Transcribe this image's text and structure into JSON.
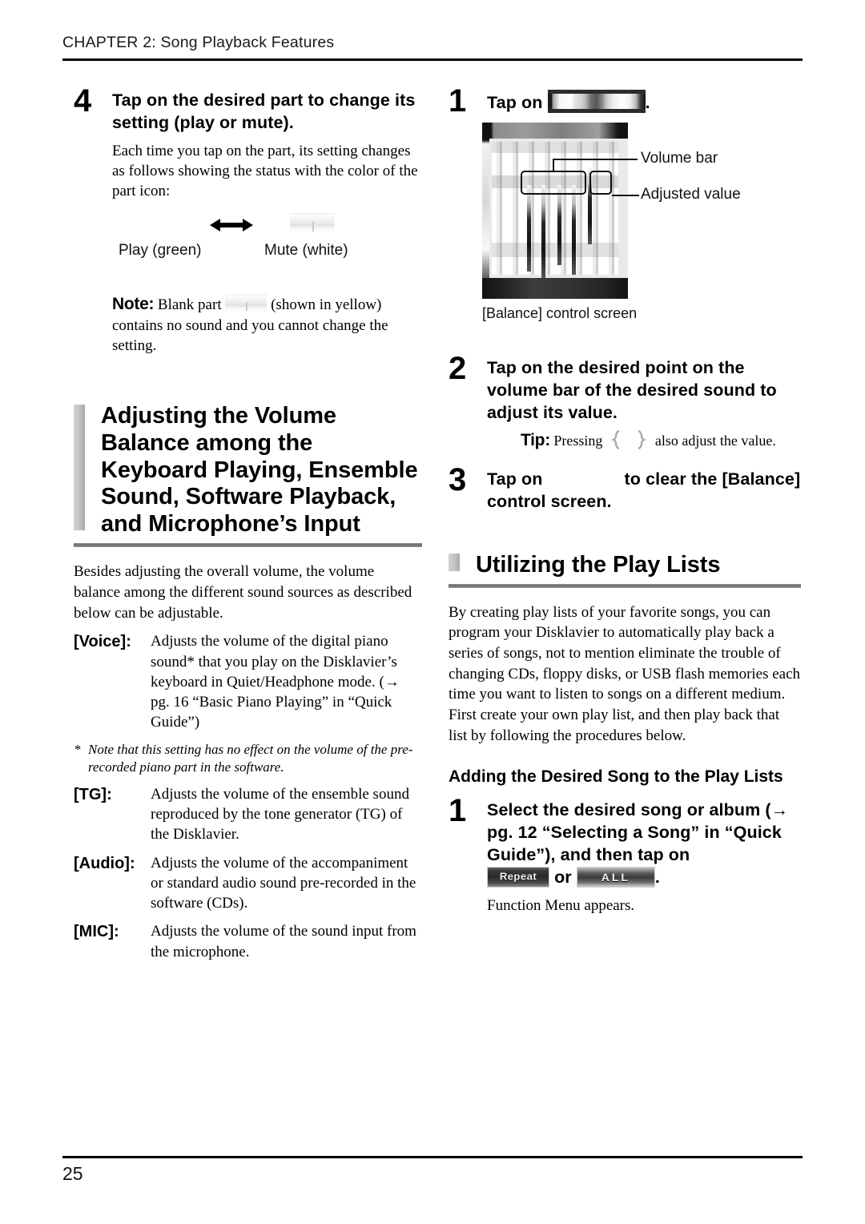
{
  "running_head": "CHAPTER 2: Song Playback Features",
  "page_number": "25",
  "left_column": {
    "step4": {
      "number": "4",
      "title": "Tap on the desired part to change its setting (play or mute).",
      "body": "Each time you tap on the part, its setting changes as follows showing the status with the color of the part icon:"
    },
    "legend": {
      "play_label": "Play (green)",
      "mute_label": "Mute (white)",
      "arrow_icon": "left-right-arrow-icon",
      "mute_icon": "part-icon-white"
    },
    "note": {
      "label": "Note:",
      "text_before_icon": "Blank part",
      "text_after_icon": "(shown in yellow) contains no sound and you cannot change the setting.",
      "blank_part_icon": "part-icon-blank"
    },
    "section_heading": "Adjusting the Volume Balance among the Keyboard Playing, Ensemble Sound, Software Playback, and Microphone’s Input",
    "intro": "Besides adjusting the overall volume, the volume balance among the different sound sources as described below can be adjustable.",
    "definitions": [
      {
        "term": "[Voice]:",
        "desc": "Adjusts the volume of the digital piano sound* that you play on the Disklavier’s keyboard in Quiet/Headphone mode. (→ pg. 16 “Basic Piano Playing” in “Quick Guide”)"
      },
      {
        "term": "[TG]:",
        "desc": "Adjusts the volume of the ensemble sound reproduced by the tone generator (TG) of the Disklavier."
      },
      {
        "term": "[Audio]:",
        "desc": "Adjusts the volume of the accompaniment or standard audio sound pre-recorded in the software (CDs)."
      },
      {
        "term": "[MIC]:",
        "desc": "Adjusts the volume of the sound input from the microphone."
      }
    ],
    "footnote": {
      "marker": "*",
      "text": "Note that this setting has no effect on the volume of the pre-recorded piano part in the software."
    }
  },
  "right_column": {
    "step1": {
      "number": "1",
      "title_before_icon": "Tap on",
      "title_after_icon": ".",
      "icon": "volume-bar-button-icon"
    },
    "figure": {
      "callout_volume_bar": "Volume bar",
      "callout_adjusted_value": "Adjusted value",
      "caption": "[Balance] control screen"
    },
    "step2": {
      "number": "2",
      "title": "Tap on the desired point on the volume bar of the desired sound to adjust its value.",
      "tip_label": "Tip:",
      "tip_before_icons": "Pressing",
      "tip_after_icons": "also adjust the value.",
      "tip_icon_left": "jog-dial-left-icon",
      "tip_icon_right": "jog-dial-right-icon"
    },
    "step3": {
      "number": "3",
      "title_before_icon": "Tap on",
      "title_after_icon": "to clear the [Balance] control screen.",
      "icon": "close-button-icon-faded"
    },
    "section_heading": "Utilizing the Play Lists",
    "intro": "By creating play lists of your favorite songs, you can program your Disklavier to automatically play back a series of songs, not to mention eliminate the trouble of changing CDs, floppy disks, or USB flash memories each time you want to listen to songs on a different medium. First create your own play list, and then play back that list by following the procedures below.",
    "sub_heading": "Adding the Desired Song to the Play Lists",
    "step1b": {
      "number": "1",
      "title": "Select the desired song or album (→ pg. 12 “Selecting a Song” in “Quick Guide”), and then tap on",
      "key_repeat_label": "Repeat",
      "key_or": "or",
      "key_all_label": "ALL",
      "trailing_period": ".",
      "body": "Function Menu appears."
    }
  }
}
